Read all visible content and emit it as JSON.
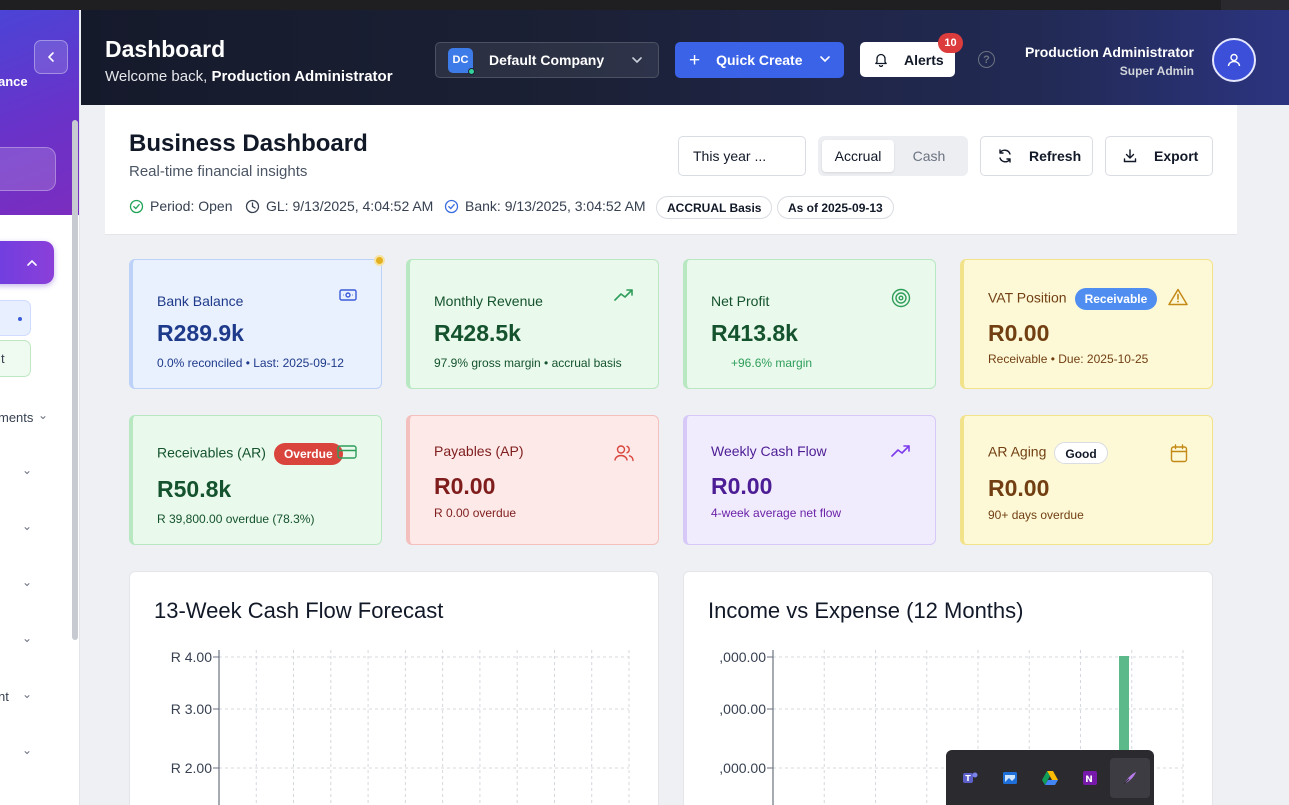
{
  "header": {
    "title": "Dashboard",
    "welcome_prefix": "Welcome back,",
    "welcome_name": "Production Administrator",
    "company": {
      "initials": "DC",
      "name": "Default Company"
    },
    "quick_create_label": "Quick Create",
    "alerts_label": "Alerts",
    "alerts_count": "10",
    "help_label": "?",
    "user": {
      "name": "Production Administrator",
      "role": "Super Admin"
    }
  },
  "sidebar": {
    "brand_fragment": "ance",
    "sub_item_fragment": "t",
    "items": [
      {
        "label": "ments",
        "chevron": "⌄"
      },
      {
        "label": "",
        "chevron": "⌄"
      },
      {
        "label": "",
        "chevron": "⌄"
      },
      {
        "label": "",
        "chevron": "⌄"
      },
      {
        "label": "",
        "chevron": "⌄"
      },
      {
        "label": "nt",
        "chevron": "⌄"
      },
      {
        "label": "",
        "chevron": "⌄"
      }
    ]
  },
  "page": {
    "title": "Business Dashboard",
    "subtitle": "Real-time financial insights",
    "period_select": "This year ...",
    "basis_toggle": {
      "active": "Accrual",
      "inactive": "Cash"
    },
    "refresh_label": "Refresh",
    "export_label": "Export",
    "period_status": "Period: Open",
    "gl_timestamp": "GL: 9/13/2025, 4:04:52 AM",
    "bank_timestamp": "Bank: 9/13/2025, 3:04:52 AM",
    "basis_pill": "ACCRUAL Basis",
    "as_of_pill": "As of 2025-09-13"
  },
  "cards": [
    {
      "title": "Bank Balance",
      "value": "R289.9k",
      "note": "0.0% reconciled • Last: 2025-09-12",
      "badge": "",
      "icon": "banknote-icon",
      "color": "#1e3a8a"
    },
    {
      "title": "Monthly Revenue",
      "value": "R428.5k",
      "note": "97.9% gross margin • accrual basis",
      "badge": "",
      "icon": "trending-up-icon",
      "color": "#14532d"
    },
    {
      "title": "Net Profit",
      "value": "R413.8k",
      "note": "+96.6% margin",
      "badge": "",
      "icon": "target-icon",
      "color": "#14532d"
    },
    {
      "title": "VAT Position",
      "value": "R0.00",
      "note": "Receivable • Due: 2025-10-25",
      "badge": "Receivable",
      "icon": "warning-icon",
      "color": "#713f12"
    },
    {
      "title": "Receivables (AR)",
      "value": "R50.8k",
      "note": "R 39,800.00 overdue (78.3%)",
      "badge": "Overdue",
      "icon": "credit-card-icon",
      "color": "#14532d"
    },
    {
      "title": "Payables (AP)",
      "value": "R0.00",
      "note": "R 0.00 overdue",
      "badge": "",
      "icon": "users-icon",
      "color": "#7f1d1d"
    },
    {
      "title": "Weekly Cash Flow",
      "value": "R0.00",
      "note": "4-week average net flow",
      "badge": "",
      "icon": "trending-up-icon",
      "color": "#4c1d95"
    },
    {
      "title": "AR Aging",
      "value": "R0.00",
      "note": "90+ days overdue",
      "badge": "Good",
      "icon": "calendar-icon",
      "color": "#713f12"
    }
  ],
  "chart_data": [
    {
      "type": "line",
      "title": "13-Week Cash Flow Forecast",
      "y_ticks": [
        "R 4.00",
        "R 3.00",
        "R 2.00"
      ],
      "y_tick_values": [
        4,
        3,
        2
      ],
      "grid": true,
      "series": []
    },
    {
      "type": "bar",
      "title": "Income vs Expense (12 Months)",
      "y_ticks": [
        ",000.00",
        ",000.00",
        ",000.00"
      ],
      "grid": true,
      "visible_bar_color": "#5cb98a",
      "series": []
    }
  ],
  "taskbar": {
    "apps": [
      "teams-icon",
      "photos-icon",
      "google-drive-icon",
      "onenote-icon",
      "pen-app-icon"
    ]
  }
}
